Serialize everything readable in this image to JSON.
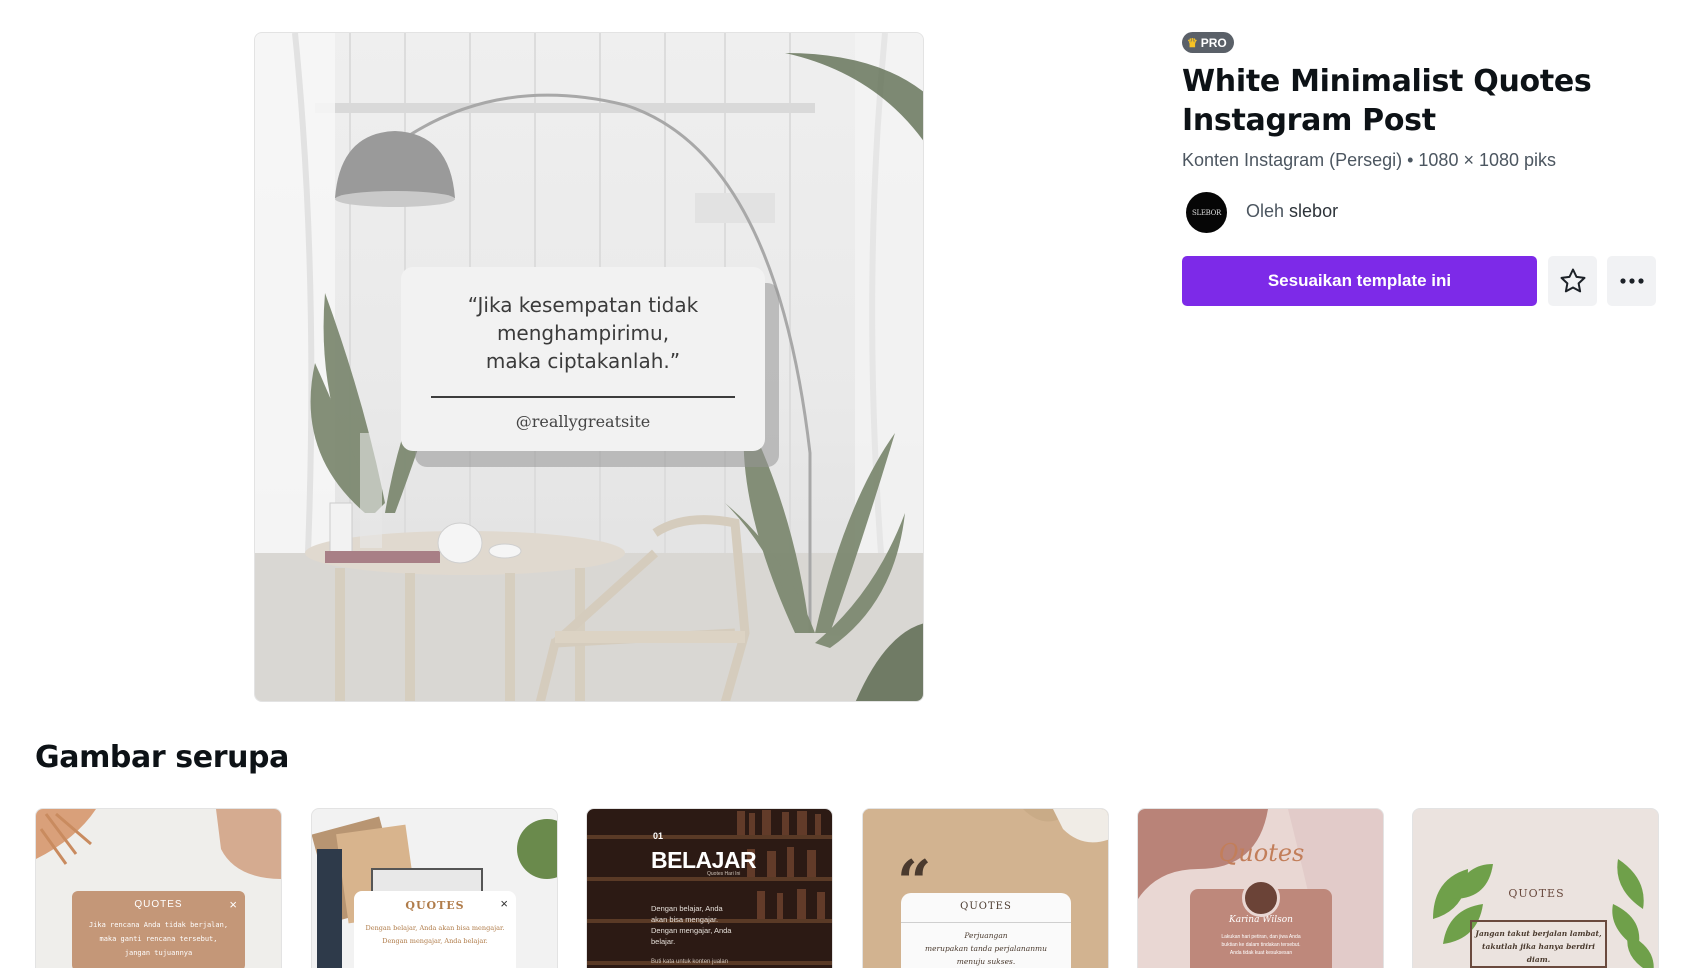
{
  "preview": {
    "quote": "“Jika kesempatan tidak\nmenghampirimu,\nmaka ciptakanlah.”",
    "handle": "@reallygreatsite"
  },
  "template": {
    "badge": "PRO",
    "badge_icon": "crown-icon",
    "title": "White Minimalist Quotes Instagram Post",
    "meta": "Konten Instagram (Persegi) • 1080 × 1080 piks",
    "author_prefix": "Oleh",
    "author_name": "slebor",
    "author_avatar_text": "SLEBOR",
    "cta_label": "Sesuaikan template ini",
    "favorite_icon": "star-icon",
    "more_icon": "more-icon"
  },
  "colors": {
    "accent": "#7d2ae8",
    "badge_bg": "#5a6068",
    "crown": "#f7c325"
  },
  "similar": {
    "title": "Gambar serupa",
    "items": [
      {
        "title": "QUOTES",
        "close": "×",
        "body": "Jika rencana Anda tidak berjalan,\nmaka ganti rencana tersebut,\njangan tujuannya"
      },
      {
        "title": "QUOTES",
        "close": "×",
        "body": "Dengan belajar, Anda akan bisa mengajar.\nDengan mengajar, Anda belajar."
      },
      {
        "number": "01",
        "title": "BELAJAR",
        "subtitle": "Quotes Hari Ini",
        "body": "Dengan belajar, Anda\nakan bisa mengajar.\nDengan mengajar, Anda\nbelajar.",
        "footer": "Buti kata untuk konten jualan"
      },
      {
        "mark": "“",
        "title": "QUOTES",
        "body": "Perjuangan\nmerupakan tanda perjalananmu\nmenuju sukses."
      },
      {
        "title": "Quotes",
        "signature": "Karina Wilson",
        "body": "Lakukan hari petiran, dan jiwa Anda\nbuktian ke dalam tindakan tersebut.\nAnda tidak kuat kesuksesan"
      },
      {
        "title": "QUOTES",
        "body": "Jangan takut berjalan lambat,\ntakutlah jika hanya berdiri diam."
      }
    ]
  }
}
